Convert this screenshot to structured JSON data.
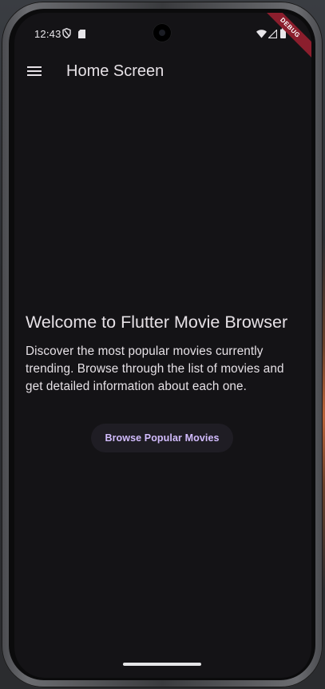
{
  "status_bar": {
    "time": "12:43",
    "icons": [
      "shield-icon",
      "sim-card-icon",
      "wifi-icon",
      "signal-icon",
      "battery-icon"
    ],
    "debug_banner": "DEBUG"
  },
  "app_bar": {
    "menu_icon": "menu-icon",
    "title": "Home Screen"
  },
  "main": {
    "welcome_title": "Welcome to Flutter Movie Browser",
    "welcome_body": "Discover the most popular movies currently trending. Browse through the list of movies and get detailed information about each one.",
    "browse_button_label": "Browse Popular Movies"
  },
  "colors": {
    "background": "#141316",
    "text": "#e6e1e6",
    "button_text": "#d2bcfd",
    "button_bg": "#1f1d24",
    "debug_ribbon": "#8b1e2d"
  }
}
